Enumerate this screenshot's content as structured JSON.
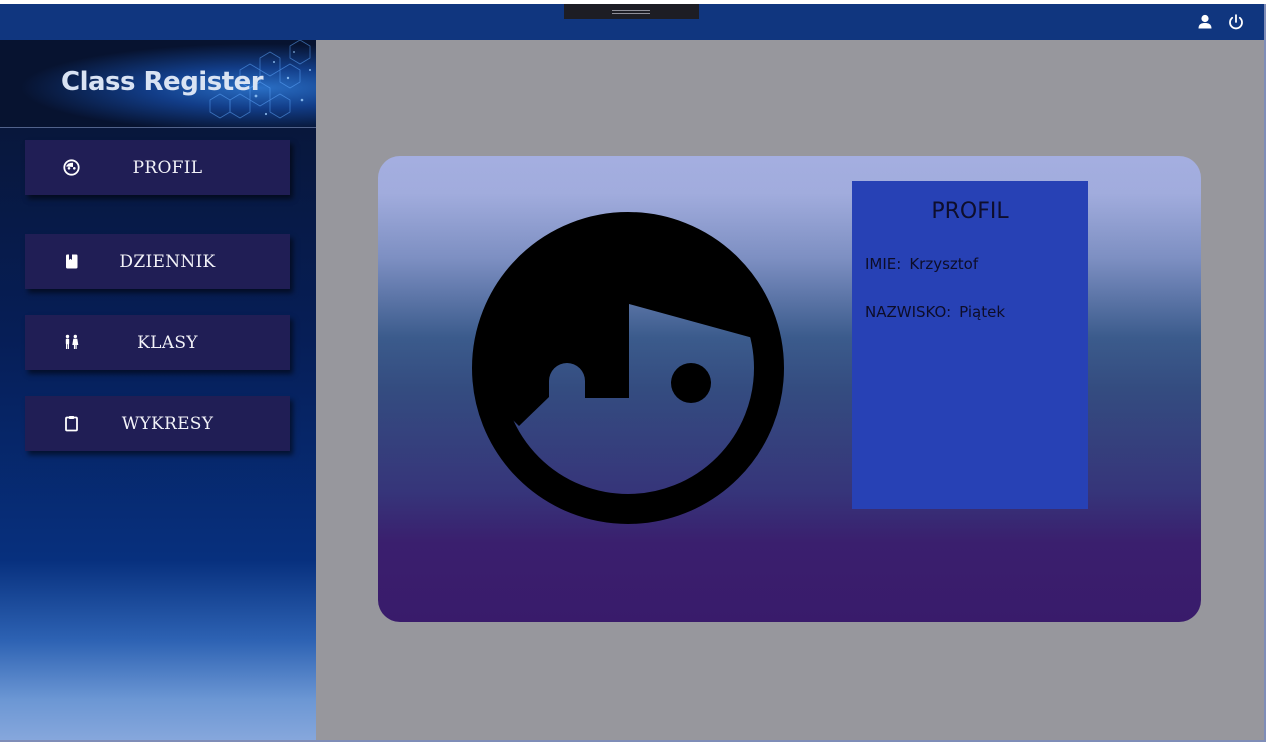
{
  "app": {
    "title": "Class Register"
  },
  "topbar": {
    "icons": [
      "user-icon",
      "power-icon"
    ]
  },
  "sidebar": {
    "items": [
      {
        "label": "PROFIL",
        "icon": "face-icon"
      },
      {
        "label": "DZIENNIK",
        "icon": "book-icon"
      },
      {
        "label": "KLASY",
        "icon": "people-icon"
      },
      {
        "label": "WYKRESY",
        "icon": "clipboard-icon"
      }
    ]
  },
  "profile": {
    "title": "PROFIL",
    "first_name_label": "IMIE:",
    "first_name": "Krzysztof",
    "last_name_label": "NAZWISKO:",
    "last_name": "Piątek"
  },
  "colors": {
    "topbar": "#10367f",
    "sidebar_button": "#201e55",
    "content_background": "#97979d",
    "profile_panel": "#2741b5"
  }
}
